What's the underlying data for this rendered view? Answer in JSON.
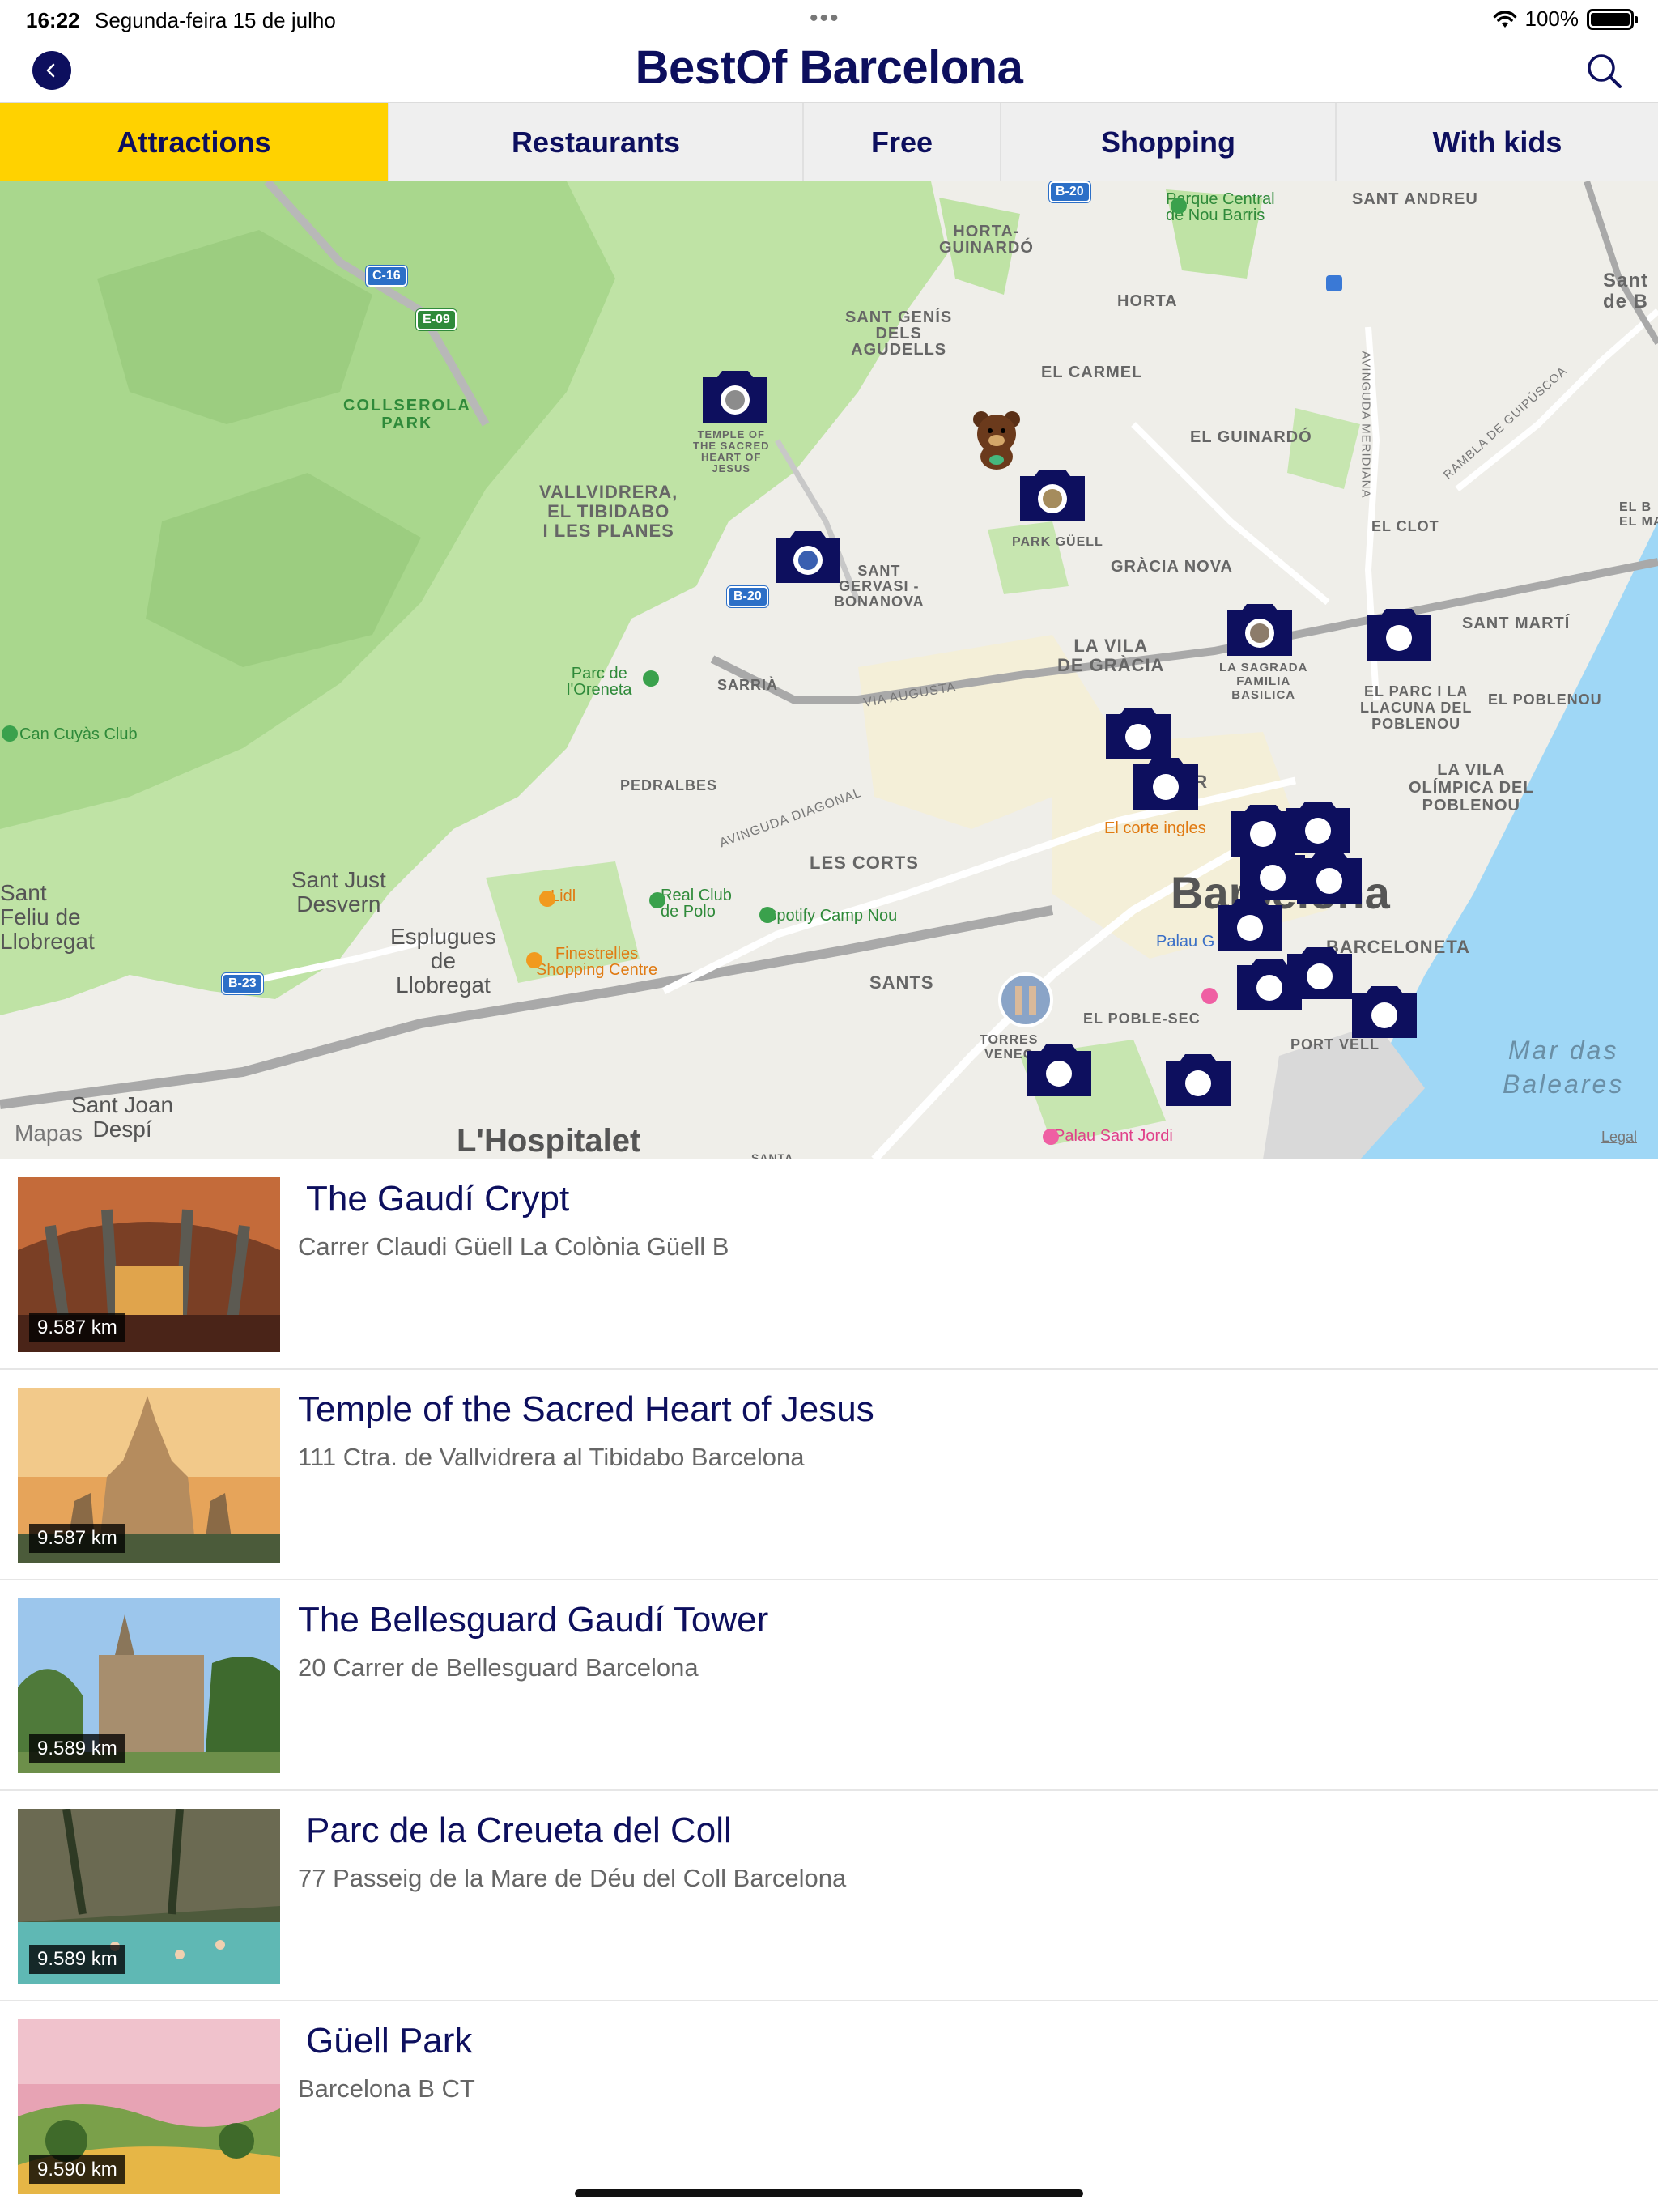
{
  "status_bar": {
    "time": "16:22",
    "date": "Segunda-feira 15 de julho",
    "battery": "100%",
    "battery_level": 1.0
  },
  "header": {
    "title": "BestOf Barcelona",
    "back_icon": "chevron-left-icon",
    "search_icon": "search-icon"
  },
  "tabs": [
    {
      "label": "Attractions",
      "active": true
    },
    {
      "label": "Restaurants",
      "active": false
    },
    {
      "label": "Free",
      "active": false
    },
    {
      "label": "Shopping",
      "active": false
    },
    {
      "label": "With kids",
      "active": false
    }
  ],
  "map": {
    "attribution": "Mapas",
    "legal": "Legal",
    "labels": {
      "sant_andreu": "SANT ANDREU",
      "horta_guinardo": "HORTA-\nGUINARDÓ",
      "horta": "HORTA",
      "el_carmel": "EL CARMEL",
      "sant_genis": "SANT GENÍS\nDELS\nAGUDELLS",
      "el_guinardo": "EL GUINARDÓ",
      "collserola": "COLLSEROLA\nPARK",
      "vallvidrera": "VALLVIDRERA,\nEL TIBIDABO\nI LES PLANES",
      "park_guell": "PARK GÜELL",
      "sant_gervasi": "SANT\nGERVASI -\nBONANOVA",
      "gracia_nova": "GRÀCIA NOVA",
      "la_vila_de_gracia": "LA VILA\nDE GRÀCIA",
      "sagrada": "LA SAGRADA\nFAMILIA\nBASILICA",
      "sant_marti": "SANT MARTÍ",
      "el_parc": "EL PARC I LA\nLLACUNA DEL\nPOBLENOU",
      "el_poblenou": "EL POBLENOU",
      "la_vila_olimpica": "LA VILA\nOLÍMPICA DEL\nPOBLENOU",
      "el_clot": "EL CLOT",
      "sarria": "SARRIÀ",
      "pedralbes": "PEDRALBES",
      "les_corts": "LES CORTS",
      "sants": "SANTS",
      "el_poble_sec": "EL POBLE-SEC",
      "barceloneta": "BARCELONETA",
      "port_vell": "PORT VELL",
      "dreta": "D'OR",
      "barcelona": "Barcelona",
      "sant_just": "Sant Just\nDesvern",
      "esplugues": "Esplugues\nde\nLlobregat",
      "sant_feliu": "Sant\nFeliu de\nLlobregat",
      "sant_joan": "Sant Joan\nDespí",
      "hospitalet": "L'Hospitalet",
      "sea": "Mar das\nBaleares",
      "parc_oreneta": "Parc de\nl'Oreneta",
      "can_cuyas": "Can Cuyàs Club",
      "parque_central": "Parque Central\nde Nou Barris",
      "real_club": "Real Club\nde Polo",
      "spotify": "Spotify Camp Nou",
      "lidl": "Lidl",
      "finestrelles": "Finestrelles\nShopping Centre",
      "el_corte": "El corte ingles",
      "palau_sant_jordi": "Palau Sant Jordi",
      "palau_g": "Palau G",
      "via_augusta": "VIA AUGUSTA",
      "diagonal": "AVINGUDA DIAGONAL",
      "meridiana": "AVINGUDA MERIDIANA",
      "guipuscoa": "RAMBLA DE GUIPÚSCOA",
      "santa": "SANTA",
      "torres_venecianes": "TORRES\nVENEC",
      "temple_label": "TEMPLE OF\nTHE SACRED\nHEART OF\nJESUS",
      "sant_e": "Sant\nde B",
      "el_b": "EL B\nEL MA"
    },
    "shields": [
      "C-16",
      "E-09",
      "B-20",
      "B-20",
      "B-23"
    ],
    "marker_color": "#0d0f5e"
  },
  "places": [
    {
      "title": "The Gaudí Crypt",
      "address": "Carrer Claudi Güell La Colònia Güell B",
      "distance": "9.587 km"
    },
    {
      "title": "Temple of the Sacred Heart of Jesus",
      "address": "111 Ctra. de Vallvidrera al Tibidabo Barcelona",
      "distance": "9.587 km"
    },
    {
      "title": "The Bellesguard Gaudí Tower",
      "address": "20 Carrer de Bellesguard Barcelona",
      "distance": "9.589 km"
    },
    {
      "title": "Parc de la Creueta del Coll",
      "address": "77 Passeig de la Mare de Déu del Coll Barcelona",
      "distance": "9.589 km"
    },
    {
      "title": "Güell Park",
      "address": "Barcelona B CT",
      "distance": "9.590 km"
    }
  ],
  "colors": {
    "brand": "#0d0f5e",
    "active_tab": "#ffd200",
    "tab_bg": "#efefef"
  }
}
